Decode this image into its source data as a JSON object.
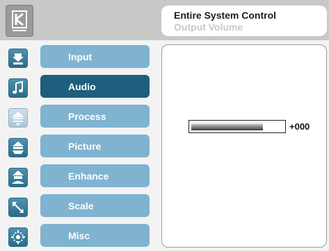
{
  "header": {
    "logo_icon": "kramer-k-logo-icon",
    "title": "Entire System Control",
    "subtitle": "Output Volume"
  },
  "menu": {
    "items": [
      {
        "label": "Input",
        "icon": "input-arrow-icon",
        "active": false
      },
      {
        "label": "Audio",
        "icon": "music-note-icon",
        "active": true
      },
      {
        "label": "Process",
        "icon": "process-icon",
        "active": false
      },
      {
        "label": "Picture",
        "icon": "picture-icon",
        "active": false
      },
      {
        "label": "Enhance",
        "icon": "enhance-icon",
        "active": false
      },
      {
        "label": "Scale",
        "icon": "scale-icon",
        "active": false
      },
      {
        "label": "Misc",
        "icon": "misc-icon",
        "active": false
      }
    ]
  },
  "volume": {
    "level_fraction": 0.78,
    "value_text": "+000"
  },
  "colors": {
    "button_inactive": "#7fb3d0",
    "button_active": "#1f5e7c",
    "icon_bg": "#3d84a3"
  }
}
